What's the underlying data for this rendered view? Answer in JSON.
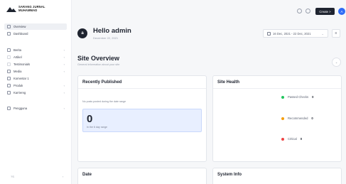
{
  "brand": {
    "name_line1": "SARANG JURNAL",
    "name_line2": "MUHAMMAD"
  },
  "sidebar": {
    "items": [
      {
        "label": "Overview",
        "has_chevron": false,
        "active": true
      },
      {
        "label": "Dashboard",
        "has_chevron": false,
        "active": false
      },
      {
        "label": "Berita",
        "has_chevron": true,
        "active": false
      },
      {
        "label": "Artikel",
        "has_chevron": true,
        "active": false
      },
      {
        "label": "Testimonials",
        "has_chevron": true,
        "active": false
      },
      {
        "label": "Media",
        "has_chevron": true,
        "active": false
      },
      {
        "label": "Komentar 1",
        "has_chevron": false,
        "active": false
      },
      {
        "label": "Produk",
        "has_chevron": true,
        "active": false
      },
      {
        "label": "Karriereg",
        "has_chevron": true,
        "active": false
      },
      {
        "label": "Pengguna",
        "has_chevron": true,
        "active": false
      }
    ],
    "footer_label": "?S"
  },
  "topbar": {
    "create_label": "Create >",
    "avatar_letter": "A"
  },
  "greeting": {
    "avatar_letter": "a",
    "title": "Hello admin",
    "date": "December 22, 2021"
  },
  "date_range": {
    "label": "16 Dec, 2021 - 22 Dec, 2021"
  },
  "section": {
    "title": "Site Overview",
    "subtitle": "General information about your site"
  },
  "recently_published": {
    "title": "Recently Published",
    "empty_text": "No posts posted during the date range",
    "count": "0",
    "count_label": "In the 6 day range"
  },
  "site_health": {
    "title": "Site Health",
    "rows": [
      {
        "label": "Passed Checks",
        "value": "0",
        "color": "#22c55e"
      },
      {
        "label": "Recommended",
        "value": "0",
        "color": "#f59e0b"
      },
      {
        "label": "Critical",
        "value": "0",
        "color": "#ef4444"
      }
    ]
  },
  "date_card": {
    "title": "Date"
  },
  "system_info": {
    "title": "System Info"
  }
}
